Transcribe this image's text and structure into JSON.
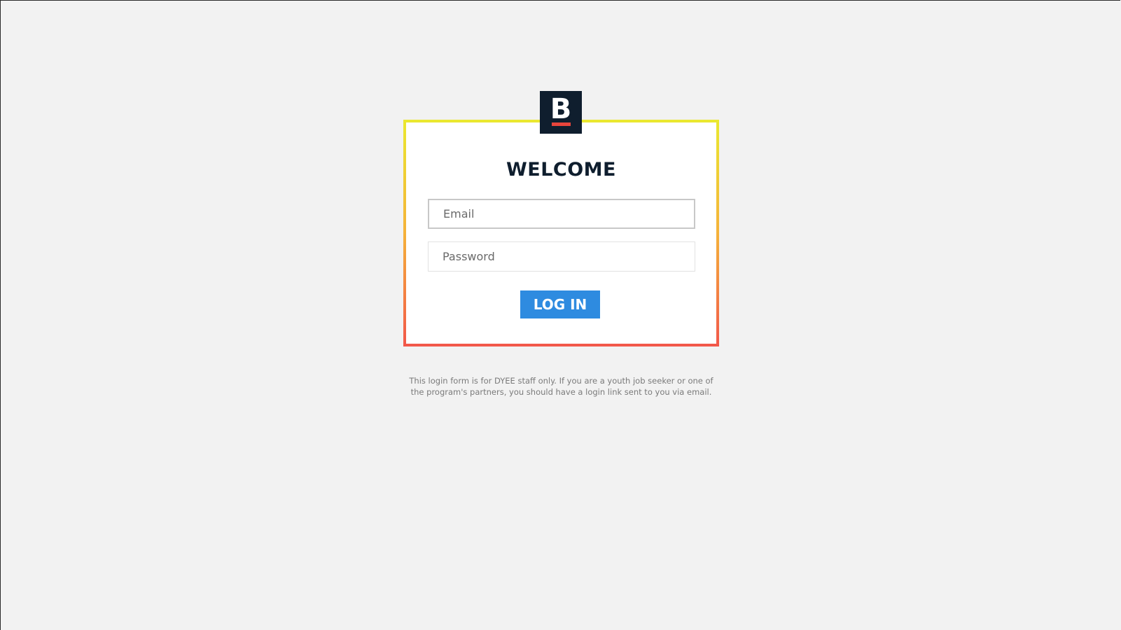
{
  "logo": {
    "letter": "B",
    "background_color": "#0f1e2e",
    "accent_color": "#e8453c"
  },
  "login_card": {
    "title": "WELCOME",
    "email": {
      "placeholder": "Email",
      "value": ""
    },
    "password": {
      "placeholder": "Password",
      "value": ""
    },
    "login_button_label": "LOG IN",
    "border_gradient": [
      "#eae830",
      "#f5b23a",
      "#f2574a"
    ],
    "button_color": "#2e8be0"
  },
  "notice": {
    "text": "This login form is for DYEE staff only. If you are a youth job seeker or one of the program's partners, you should have a login link sent to you via email."
  }
}
